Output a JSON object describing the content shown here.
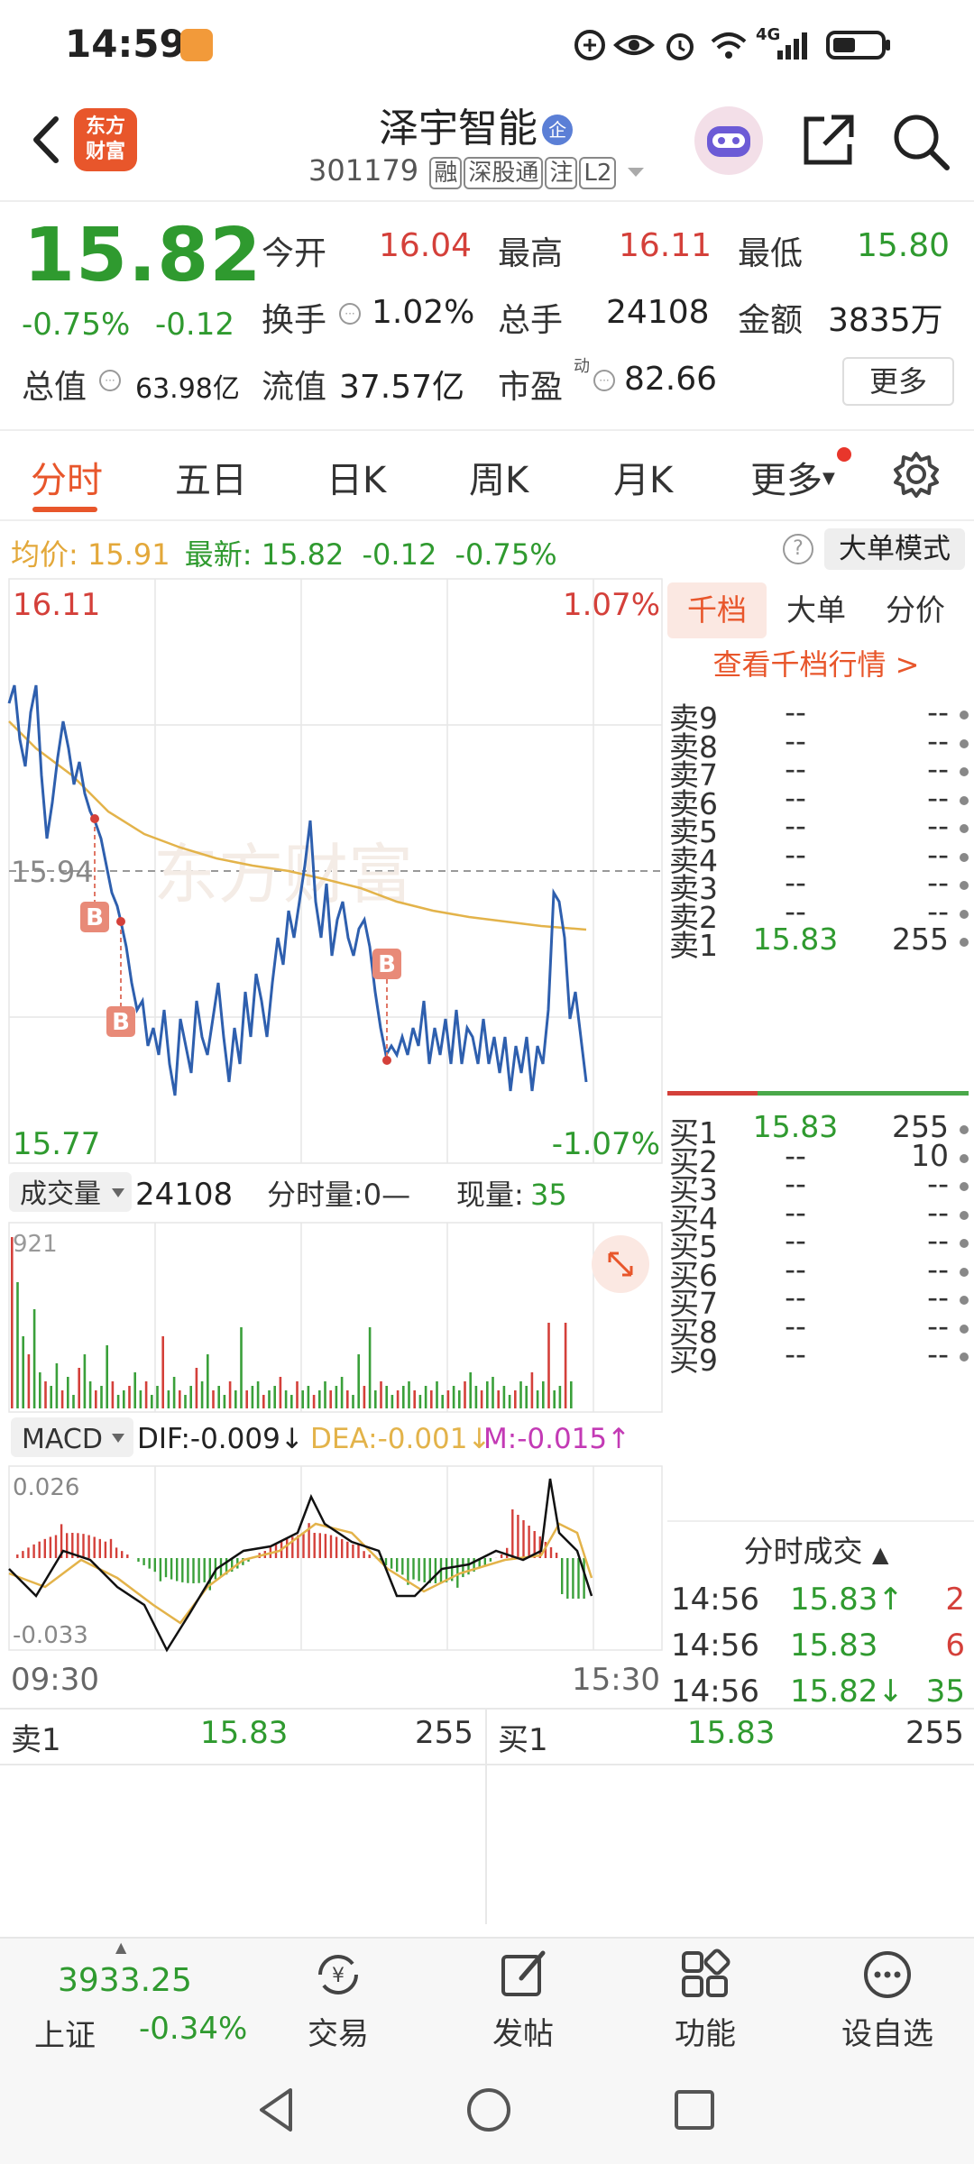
{
  "status_bar": {
    "time": "14:59",
    "network": "4G"
  },
  "header": {
    "brand": "东方财富",
    "brand_line1": "东方",
    "brand_line2": "财富",
    "stock_name": "泽宇智能",
    "name_badge": "企",
    "stock_code": "301179",
    "tags": [
      "融",
      "深股通",
      "注",
      "L2"
    ]
  },
  "quote": {
    "price": "15.82",
    "change_pct": "-0.75%",
    "change_amt": "-0.12",
    "open_label": "今开",
    "open": "16.04",
    "high_label": "最高",
    "high": "16.11",
    "low_label": "最低",
    "low": "15.80",
    "turnover_label": "换手",
    "turnover": "1.02%",
    "volume_label": "总手",
    "volume": "24108",
    "amount_label": "金额",
    "amount": "3835万",
    "mktcap_label": "总值",
    "mktcap": "63.98亿",
    "float_label": "流值",
    "float_cap": "37.57亿",
    "pe_label": "市盈",
    "pe_sup": "动",
    "pe": "82.66",
    "more_label": "更多"
  },
  "tabs": [
    "分时",
    "五日",
    "日K",
    "周K",
    "月K",
    "更多"
  ],
  "info_row": {
    "avg_label": "均价:",
    "avg": "15.91",
    "last_label": "最新:",
    "last": "15.82",
    "chg": "-0.12",
    "pct": "-0.75%",
    "help": "?",
    "big_order_mode": "大单模式"
  },
  "chart": {
    "high_label": "16.11",
    "high_pct": "1.07%",
    "pre_close": "15.94",
    "low_label": "15.77",
    "low_pct": "-1.07%",
    "watermark": "东方财富",
    "volume_selector": "成交量",
    "volume_total": "24108",
    "minute_vol_label": "分时量:0—",
    "current_vol_label": "现量:",
    "current_vol": "35",
    "volume_max": "921",
    "macd_selector": "MACD",
    "dif": "DIF:-0.009↓",
    "dea": "DEA:-0.001↓",
    "m": "M:-0.015↑",
    "macd_max": "0.026",
    "macd_min": "-0.033",
    "time_start": "09:30",
    "time_end": "15:30",
    "trade_marker": "B"
  },
  "order_book": {
    "tabs": [
      "千档",
      "大单",
      "分价"
    ],
    "detail_link": "查看千档行情 >",
    "asks": [
      {
        "label": "卖9",
        "price": "--",
        "vol": "--"
      },
      {
        "label": "卖8",
        "price": "--",
        "vol": "--"
      },
      {
        "label": "卖7",
        "price": "--",
        "vol": "--"
      },
      {
        "label": "卖6",
        "price": "--",
        "vol": "--"
      },
      {
        "label": "卖5",
        "price": "--",
        "vol": "--"
      },
      {
        "label": "卖4",
        "price": "--",
        "vol": "--"
      },
      {
        "label": "卖3",
        "price": "--",
        "vol": "--"
      },
      {
        "label": "卖2",
        "price": "--",
        "vol": "--"
      },
      {
        "label": "卖1",
        "price": "15.83",
        "vol": "255"
      }
    ],
    "bids": [
      {
        "label": "买1",
        "price": "15.83",
        "vol": "255"
      },
      {
        "label": "买2",
        "price": "--",
        "vol": "10"
      },
      {
        "label": "买3",
        "price": "--",
        "vol": "--"
      },
      {
        "label": "买4",
        "price": "--",
        "vol": "--"
      },
      {
        "label": "买5",
        "price": "--",
        "vol": "--"
      },
      {
        "label": "买6",
        "price": "--",
        "vol": "--"
      },
      {
        "label": "买7",
        "price": "--",
        "vol": "--"
      },
      {
        "label": "买8",
        "price": "--",
        "vol": "--"
      },
      {
        "label": "买9",
        "price": "--",
        "vol": "--"
      }
    ],
    "ticks_header": "分时成交",
    "ticks": [
      {
        "time": "14:56",
        "price": "15.83↑",
        "vol": "2",
        "color": "#2f9a2f",
        "vcolor": "#d4403a"
      },
      {
        "time": "14:56",
        "price": "15.83",
        "vol": "6",
        "color": "#2f9a2f",
        "vcolor": "#d4403a"
      },
      {
        "time": "14:56",
        "price": "15.82↓",
        "vol": "35",
        "color": "#2f9a2f",
        "vcolor": "#2f9a2f"
      }
    ]
  },
  "level1": {
    "ask_label": "卖1",
    "ask_price": "15.83",
    "ask_vol": "255",
    "bid_label": "买1",
    "bid_price": "15.83",
    "bid_vol": "255"
  },
  "bottom_nav": {
    "index_value": "3933.25",
    "index_name": "上证",
    "index_change": "-0.34%",
    "items": [
      "交易",
      "发帖",
      "功能",
      "设自选"
    ]
  },
  "colors": {
    "up": "#d4403a",
    "down": "#2f9a2f",
    "accent": "#e8562b",
    "line": "#2e5fae",
    "avg": "#e3b34a"
  }
}
